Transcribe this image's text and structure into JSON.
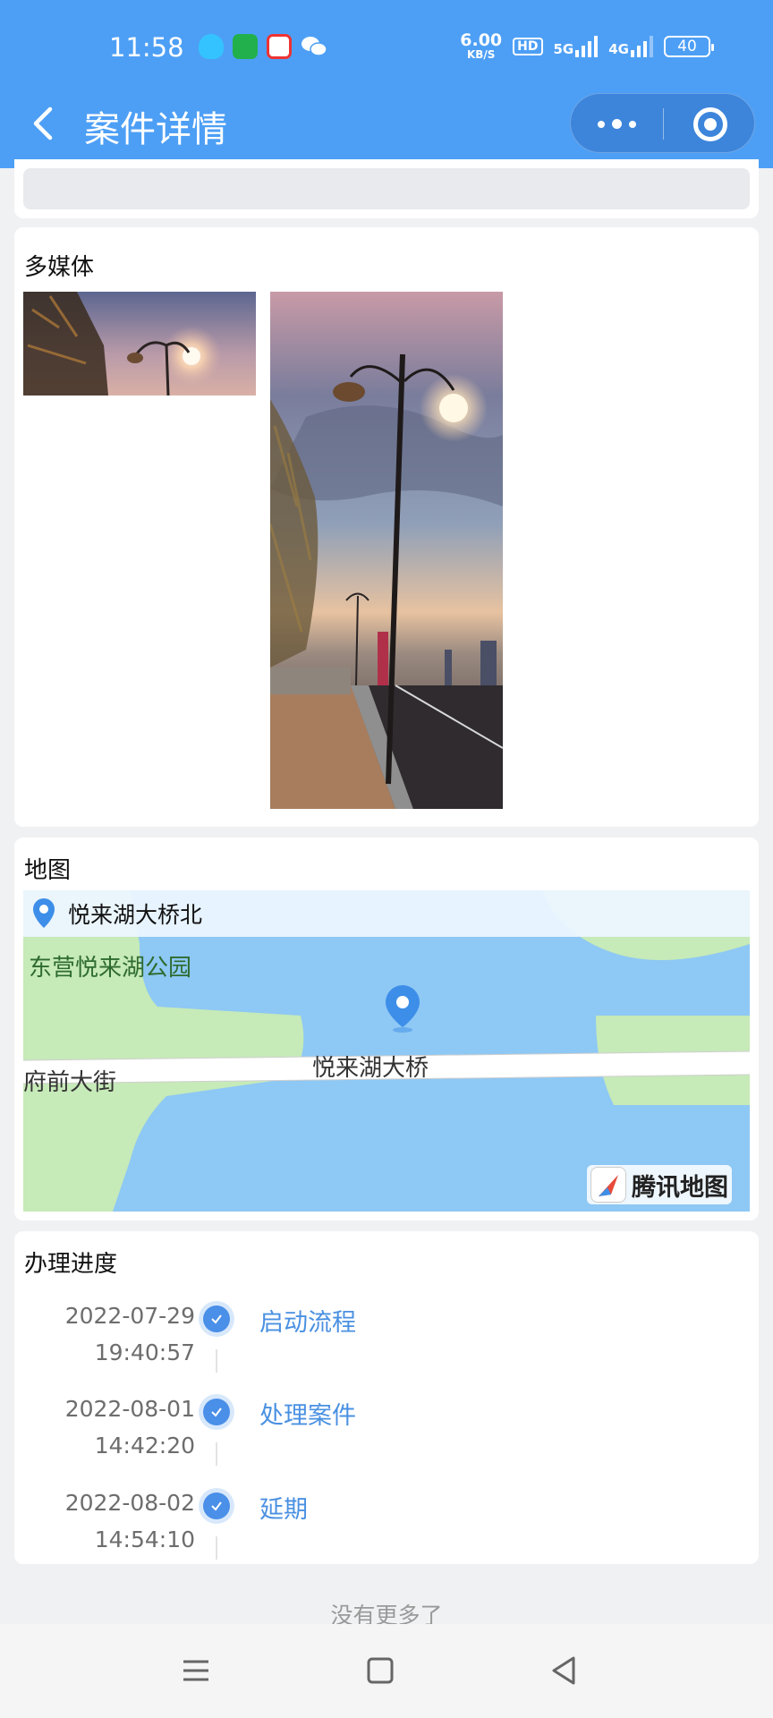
{
  "status_bar": {
    "time": "11:58",
    "net_speed_value": "6.00",
    "net_speed_unit": "KB/S",
    "hd": "HD",
    "sig1": "5G",
    "sig2": "4G",
    "battery": "40",
    "app_icons": [
      "qq-icon",
      "messages-icon",
      "baidu-icon",
      "wechat-icon"
    ]
  },
  "nav": {
    "title": "案件详情",
    "more_icon": "more-dots-icon",
    "close_icon": "target-circle-icon"
  },
  "media": {
    "title": "多媒体",
    "photos": [
      "street-lamp-photo-1",
      "street-lamp-photo-2"
    ]
  },
  "map": {
    "title": "地图",
    "location": "悦来湖大桥北",
    "labels": {
      "park": "东营悦来湖公园",
      "bridge": "悦来湖大桥",
      "street": "府前大街"
    },
    "brand": "腾讯地图"
  },
  "progress": {
    "title": "办理进度",
    "steps": [
      {
        "date": "2022-07-29",
        "time": "19:40:57",
        "label": "启动流程"
      },
      {
        "date": "2022-08-01",
        "time": "14:42:20",
        "label": "处理案件"
      },
      {
        "date": "2022-08-02",
        "time": "14:54:10",
        "label": "延期"
      }
    ]
  },
  "footer": {
    "no_more": "没有更多了"
  },
  "colors": {
    "primary": "#4d9ff5",
    "accent": "#4a8fe8",
    "map_water": "#8ec8f4",
    "map_land": "#c6eab8"
  }
}
